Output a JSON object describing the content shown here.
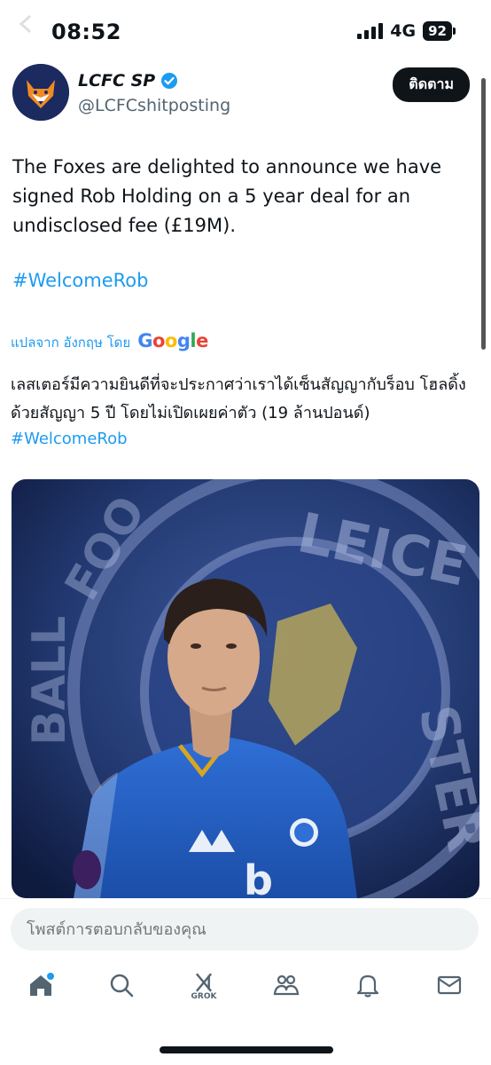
{
  "status_bar": {
    "time": "08:52",
    "network": "4G",
    "battery": "92"
  },
  "tweet": {
    "author_name": "LCFC SP",
    "author_handle": "@LCFCshitposting",
    "follow_label": "ติดตาม",
    "text": "The Foxes are delighted to announce we have signed Rob Holding on a 5 year deal for an undisclosed fee (£19M).",
    "hashtag": "#WelcomeRob",
    "translation_label": "แปลจาก อังกฤษ โดย",
    "translation_provider": "Google",
    "translated_text": "เลสเตอร์มีความยินดีที่จะประกาศว่าเราได้เซ็นสัญญากับร็อบ โฮลดิ้ง ด้วยสัญญา 5 ปี โดยไม่เปิดเผยค่าตัว (19 ล้านปอนด์)",
    "translated_hashtag": "#WelcomeRob"
  },
  "reply": {
    "placeholder": "โพสต์การตอบกลับของคุณ"
  },
  "tabbar": {
    "grok_label": "GROK",
    "icons": [
      "home-icon",
      "search-icon",
      "grok-icon",
      "communities-icon",
      "notifications-icon",
      "messages-icon"
    ]
  },
  "colors": {
    "accent": "#1d9bf0",
    "text": "#0f1419",
    "muted": "#536471"
  }
}
